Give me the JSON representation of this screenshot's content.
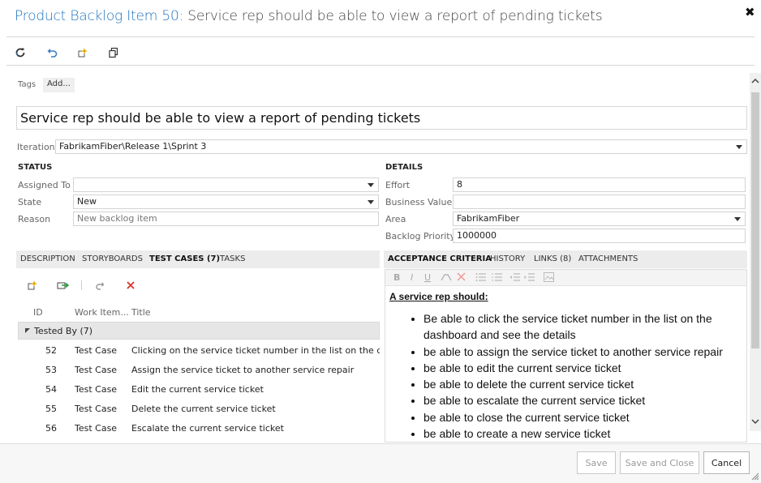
{
  "header": {
    "work_item_type": "Product Backlog Item 50:",
    "work_item_title": " Service rep should be able to view a report of pending tickets",
    "close_symbol": "✖"
  },
  "toolbar": {
    "icons": [
      "refresh-icon",
      "undo-icon",
      "new-linked-item-icon",
      "copy-icon"
    ]
  },
  "tags": {
    "label": "Tags",
    "add_label": "Add..."
  },
  "title_field": {
    "value": "Service rep should be able to view a report of pending tickets"
  },
  "iteration": {
    "label": "Iteration",
    "value": "FabrikamFiber\\Release 1\\Sprint 3"
  },
  "status": {
    "heading": "STATUS",
    "assigned_to_label": "Assigned To",
    "assigned_to_value": "",
    "state_label": "State",
    "state_value": "New",
    "reason_label": "Reason",
    "reason_value": "New backlog item"
  },
  "details": {
    "heading": "DETAILS",
    "effort_label": "Effort",
    "effort_value": "8",
    "business_value_label": "Business Value",
    "business_value_value": "",
    "area_label": "Area",
    "area_value": "FabrikamFiber",
    "backlog_priority_label": "Backlog Priority",
    "backlog_priority_value": "1000000"
  },
  "left_tabs": {
    "description": "DESCRIPTION",
    "storyboards": "STORYBOARDS",
    "test_cases": "TEST CASES (7)",
    "tasks": "TASKS"
  },
  "test_cases": {
    "columns": {
      "id": "ID",
      "work_item_type": "Work Item...",
      "title": "Title"
    },
    "group_label": "Tested By (7)",
    "rows": [
      {
        "id": "52",
        "type": "Test Case",
        "title": "Clicking on the service ticket number in the list on the dashbo"
      },
      {
        "id": "53",
        "type": "Test Case",
        "title": "Assign the service ticket to another service repair"
      },
      {
        "id": "54",
        "type": "Test Case",
        "title": "Edit the current service ticket"
      },
      {
        "id": "55",
        "type": "Test Case",
        "title": "Delete the current service ticket"
      },
      {
        "id": "56",
        "type": "Test Case",
        "title": "Escalate the current service ticket"
      }
    ]
  },
  "right_tabs": {
    "acceptance_criteria": "ACCEPTANCE CRITERIA",
    "history": "HISTORY",
    "links": "LINKS (8)",
    "attachments": "ATTACHMENTS"
  },
  "acceptance_criteria": {
    "heading": "A service rep should:",
    "items": [
      "Be able to click the service ticket number in the list on the dashboard and see the details",
      "be able to assign the service ticket to another service repair",
      "be able to edit the current service ticket",
      "be able to delete the current service ticket",
      "be able to escalate the current service ticket",
      "be able to close the current service ticket",
      "be able to create a new service ticket"
    ]
  },
  "footer": {
    "save": "Save",
    "save_and_close": "Save and Close",
    "cancel": "Cancel"
  }
}
